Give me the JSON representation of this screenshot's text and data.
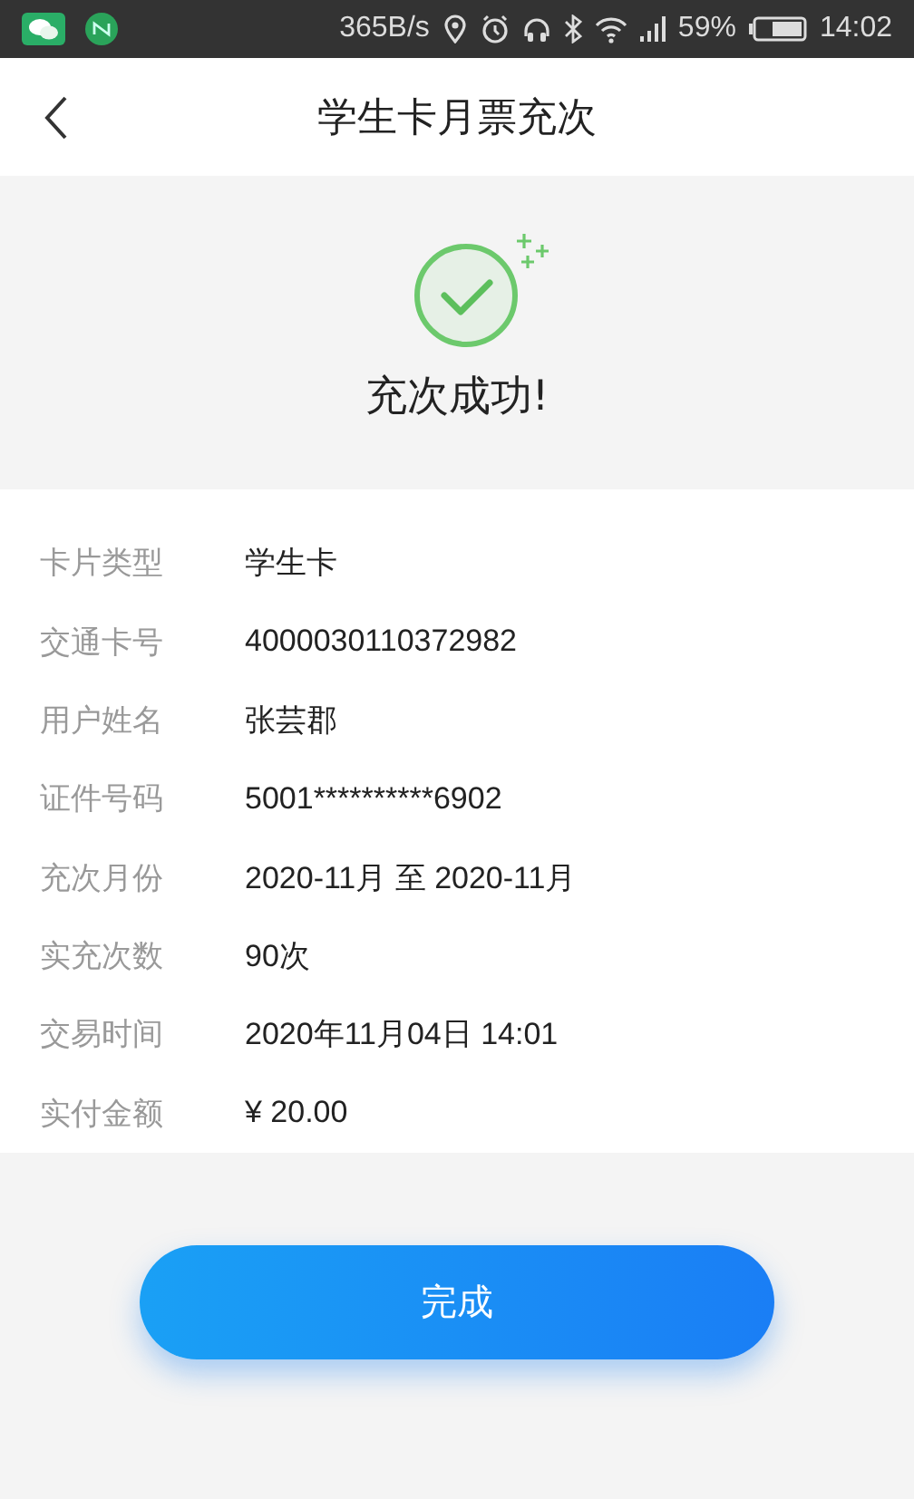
{
  "status_bar": {
    "speed": "365B/s",
    "battery": "59%",
    "time": "14:02"
  },
  "nav": {
    "title": "学生卡月票充次"
  },
  "result": {
    "message": "充次成功!"
  },
  "details": [
    {
      "label": "卡片类型",
      "value": "学生卡"
    },
    {
      "label": "交通卡号",
      "value": "4000030110372982"
    },
    {
      "label": "用户姓名",
      "value": "张芸郡"
    },
    {
      "label": "证件号码",
      "value": "5001**********6902"
    },
    {
      "label": "充次月份",
      "value": "2020-11月 至 2020-11月"
    },
    {
      "label": "实充次数",
      "value": "90次"
    },
    {
      "label": "交易时间",
      "value": "2020年11月04日 14:01"
    },
    {
      "label": "实付金额",
      "value": "¥ 20.00"
    }
  ],
  "button": "完成"
}
